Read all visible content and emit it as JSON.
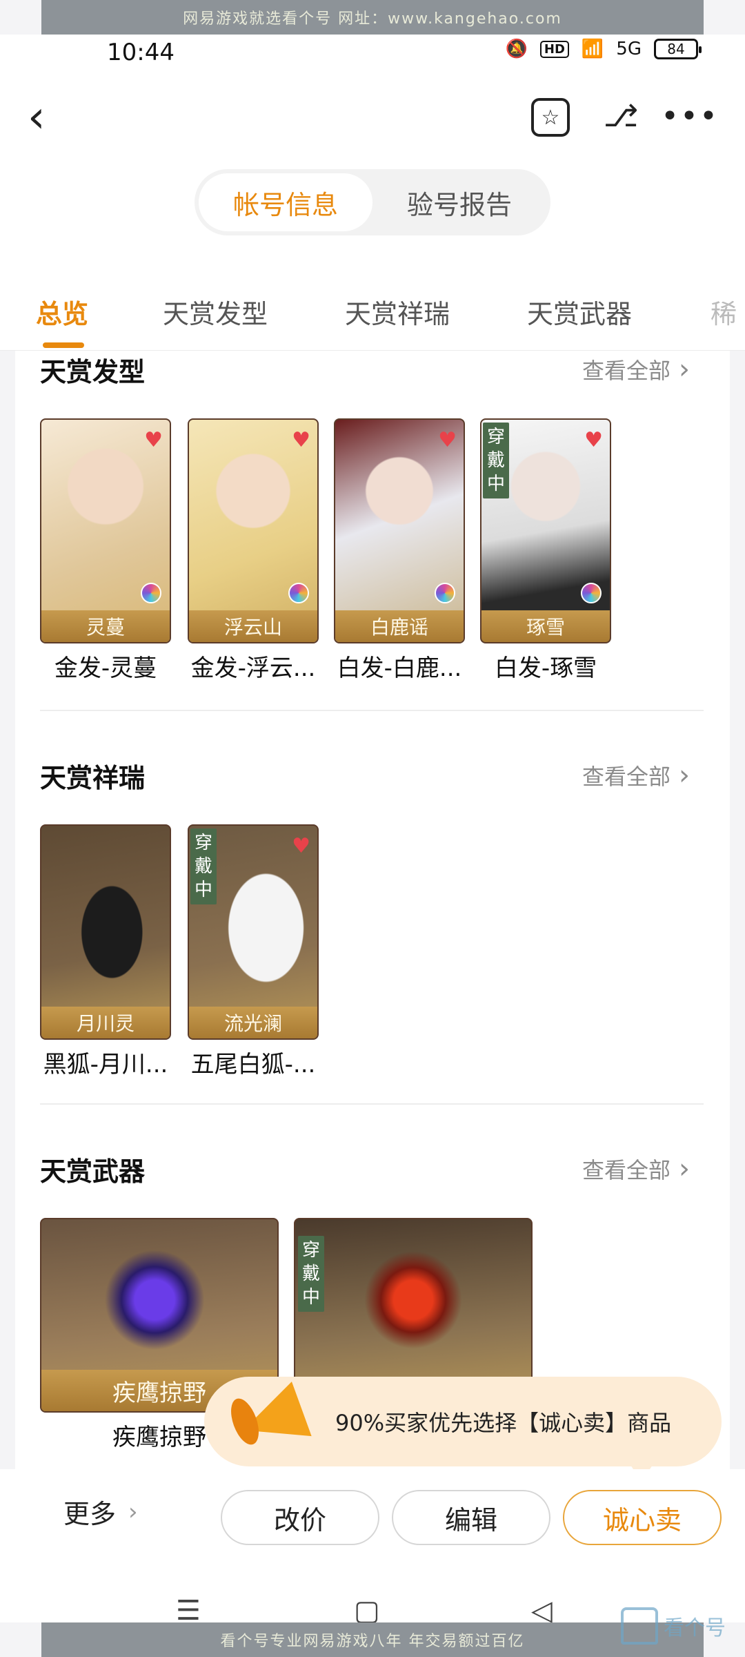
{
  "watermark": {
    "top": "网易游戏就选看个号  网址：www.kangehao.com",
    "bottom": "看个号专业网易游戏八年  年交易额过百亿",
    "logo_text": "看个号"
  },
  "status_bar": {
    "time": "10:44",
    "hd": "HD",
    "network": "5G",
    "battery": "84"
  },
  "header": {
    "back_icon": "chevron-left-icon",
    "segment": [
      "帐号信息",
      "验号报告"
    ],
    "active_segment": 0
  },
  "tabs": {
    "items": [
      "总览",
      "天赏发型",
      "天赏祥瑞",
      "天赏武器",
      "稀"
    ],
    "active": 0
  },
  "sections": {
    "hair": {
      "title": "天赏发型",
      "see_all": "查看全部",
      "items": [
        {
          "name": "灵蔓",
          "caption": "金发-灵蔓"
        },
        {
          "name": "浮云山",
          "caption": "金发-浮云..."
        },
        {
          "name": "白鹿谣",
          "caption": "白发-白鹿..."
        },
        {
          "name": "琢雪",
          "caption": "白发-琢雪",
          "badge": "穿戴中"
        }
      ]
    },
    "mount": {
      "title": "天赏祥瑞",
      "see_all": "查看全部",
      "items": [
        {
          "name": "月川灵",
          "caption": "黑狐-月川..."
        },
        {
          "name": "流光澜",
          "caption": "五尾白狐-...",
          "badge": "穿戴中"
        }
      ]
    },
    "weapon": {
      "title": "天赏武器",
      "see_all": "查看全部",
      "items": [
        {
          "name": "疾鹰掠野",
          "caption": "疾鹰掠野"
        },
        {
          "name": "",
          "caption": "",
          "badge": "穿戴中"
        }
      ]
    }
  },
  "promo": {
    "text": "90%买家优先选择【诚心卖】商品"
  },
  "actions": {
    "more": "更多",
    "change_price": "改价",
    "edit": "编辑",
    "sincere_sell": "诚心卖"
  }
}
